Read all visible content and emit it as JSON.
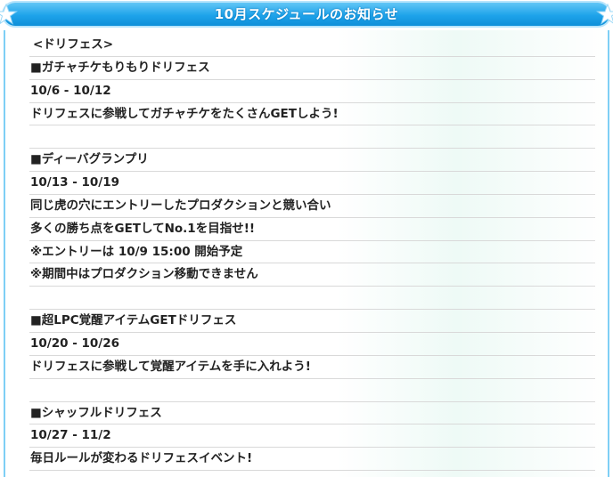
{
  "header": {
    "title": "10月スケジュールのお知らせ",
    "color": "#1ea3ea"
  },
  "rows": [
    "<ドリフェス>",
    "■ガチャチケもりもりドリフェス",
    "10/6 - 10/12",
    "ドリフェスに参戦してガチャチケをたくさんGETしよう!",
    "",
    "■ディーバグランプリ",
    "10/13 - 10/19",
    "同じ虎の穴にエントリーしたプロダクションと競い合い",
    "多くの勝ち点をGETしてNo.1を目指せ!!",
    "※エントリーは 10/9 15:00 開始予定",
    "※期間中はプロダクション移動できません",
    "",
    "■超LPC覚醒アイテムGETドリフェス",
    "10/20 - 10/26",
    "ドリフェスに参戦して覚醒アイテムを手に入れよう!",
    "",
    "■シャッフルドリフェス",
    "10/27 - 11/2",
    "毎日ルールが変わるドリフェスイベント!"
  ]
}
